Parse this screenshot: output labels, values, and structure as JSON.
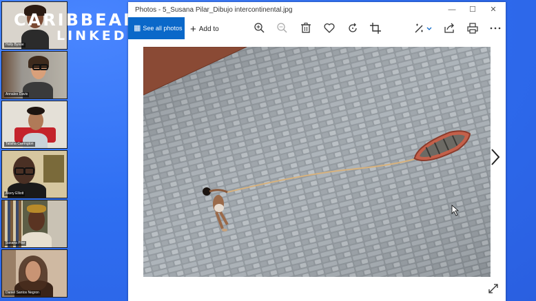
{
  "participants": [
    {
      "name": "Holly Bynoe",
      "bg": "#d9d4cc",
      "skin": "#7a4a33"
    },
    {
      "name": "Annalee Davis",
      "bg": "#8c8a86",
      "skin": "#d9a07a"
    },
    {
      "name": "Tatisha Carrington",
      "bg": "#e4e0d7",
      "skin": "#b07a58"
    },
    {
      "name": "Akery Elliott",
      "bg": "#d6c7a0",
      "skin": "#4a3024"
    },
    {
      "name": "Susana Pilar",
      "bg": "#5d5e46",
      "skin": "#5a3422"
    },
    {
      "name": "Daniel Santos Negron",
      "bg": "#cfb9a2",
      "skin": "#c99474"
    }
  ],
  "logo": {
    "line1": "CARIBBEAN",
    "line2": "LINKED"
  },
  "window": {
    "title": "Photos - 5_Susana Pilar_Dibujo intercontinental.jpg",
    "minimize_label": "—",
    "maximize_label": "☐",
    "close_label": "✕"
  },
  "toolbar": {
    "see_all_label": "See all photos",
    "add_to_label": "Add to",
    "icons": [
      "zoom-in-icon",
      "zoom-out-icon",
      "delete-icon",
      "favorite-icon",
      "rotate-icon",
      "crop-icon",
      "edit-icon",
      "share-icon",
      "print-icon",
      "more-icon"
    ]
  },
  "colors": {
    "accent": "#0a68c9",
    "background": "#2f6ff2"
  }
}
